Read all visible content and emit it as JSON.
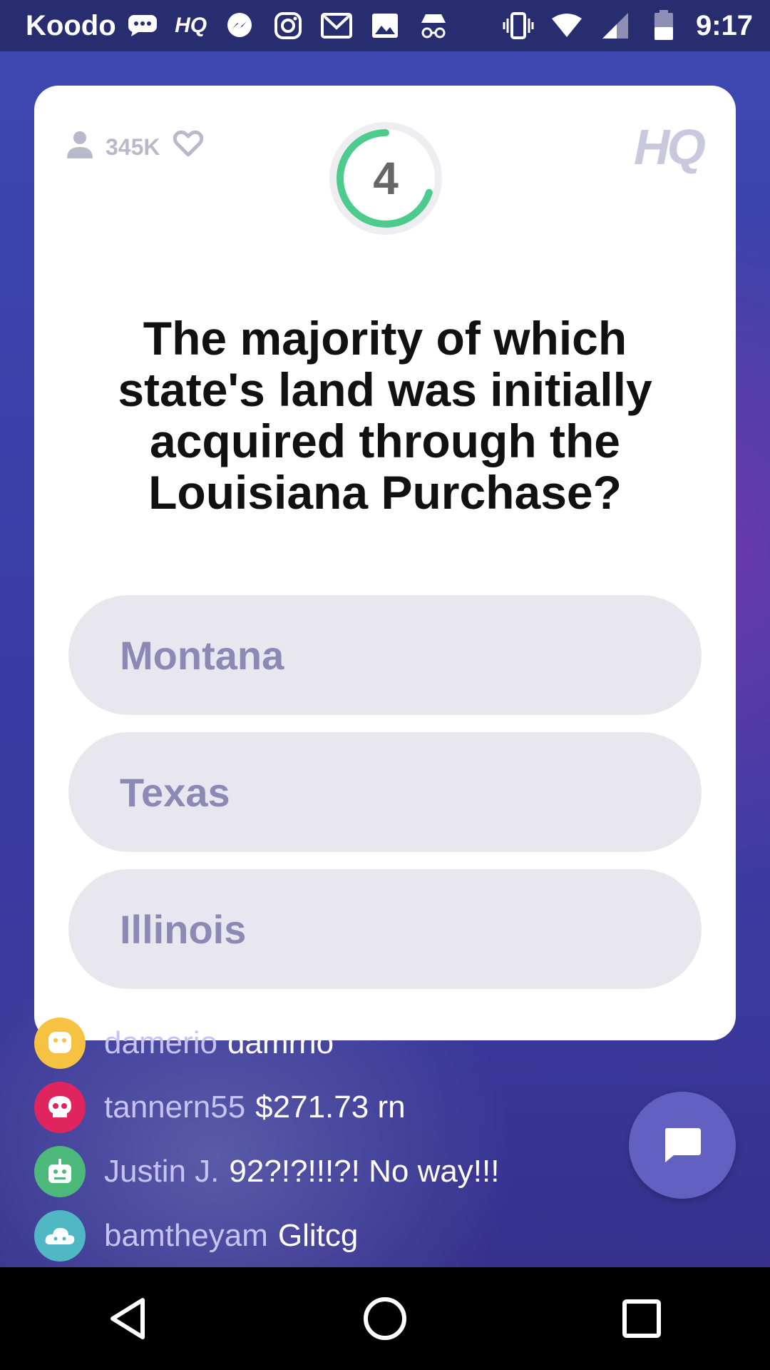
{
  "status_bar": {
    "carrier": "Koodo",
    "time": "9:17",
    "icons": [
      "chat-bubble-icon",
      "hq-icon",
      "messenger-icon",
      "instagram-icon",
      "gmail-icon",
      "gallery-icon",
      "incognito-icon",
      "vibrate-icon",
      "wifi-icon",
      "signal-icon",
      "battery-icon"
    ]
  },
  "game": {
    "viewers": "345K",
    "logo": "HQ",
    "timer": "4",
    "timer_progress": 0.7,
    "question": "The majority of which state's land was initially acquired through the Louisiana Purchase?",
    "answers": [
      "Montana",
      "Texas",
      "Illinois"
    ]
  },
  "chat": {
    "messages": [
      {
        "user": "damerio",
        "text": "damrrio",
        "avatar_color": "#f5c242",
        "avatar_icon": "smiley-icon"
      },
      {
        "user": "tannern55",
        "text": "$271.73 rn",
        "avatar_color": "#e0245e",
        "avatar_icon": "skull-icon"
      },
      {
        "user": "Justin J.",
        "text": "92?!?!!!?! No way!!!",
        "avatar_color": "#4cb87a",
        "avatar_icon": "robot-icon"
      },
      {
        "user": "bamtheyam",
        "text": "Glitcg",
        "avatar_color": "#4fb8c4",
        "avatar_icon": "cloud-icon"
      }
    ]
  },
  "colors": {
    "timer_green": "#4ccb8c",
    "answer_bg": "#e8e7ef",
    "answer_text": "#8d89b5",
    "chat_button": "#6261c2"
  }
}
